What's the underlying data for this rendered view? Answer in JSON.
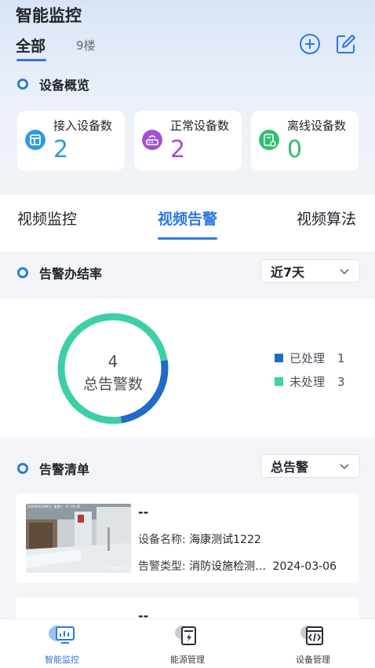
{
  "header": {
    "title": "智能监控",
    "tabs": [
      {
        "label": "全部",
        "active": true
      },
      {
        "label": "9楼",
        "active": false
      }
    ],
    "icons": [
      "add-circle-icon",
      "edit-icon"
    ]
  },
  "overview": {
    "title": "设备概览",
    "cards": [
      {
        "label": "接入设备数",
        "value": "2",
        "icon": "device-icon",
        "color": "#2b9be6"
      },
      {
        "label": "正常设备数",
        "value": "2",
        "icon": "router-icon",
        "color": "#a24fd6"
      },
      {
        "label": "离线设备数",
        "value": "0",
        "icon": "offline-device-icon",
        "color": "#2fbf71"
      }
    ]
  },
  "main_tabs": [
    {
      "label": "视频监控",
      "active": false
    },
    {
      "label": "视频告警",
      "active": true
    },
    {
      "label": "视频算法",
      "active": false
    }
  ],
  "rate_section": {
    "title": "告警办结率",
    "range_select": "近7天"
  },
  "donut": {
    "total_value": "4",
    "total_label": "总告警数",
    "legend": [
      {
        "label": "已处理",
        "count": "1",
        "value": 1,
        "color": "#1f6cc6"
      },
      {
        "label": "未处理",
        "count": "3",
        "value": 3,
        "color": "#3dcfa6"
      }
    ]
  },
  "alarm_list": {
    "title": "告警清单",
    "filter_select": "总告警",
    "items": [
      {
        "title": "--",
        "device_label": "设备名称:",
        "device_name": "海康测试1222",
        "type_label": "告警类型:",
        "type_value": "消防设施检测…",
        "date": "2024-03-06",
        "thumb_timestamp": "2024年03月06日 星期三 11:19:45",
        "thumb_camera": "Camera 01"
      },
      {
        "title": "--"
      }
    ]
  },
  "bottom_nav": [
    {
      "label": "智能监控",
      "icon": "monitor-chart-icon",
      "active": true
    },
    {
      "label": "能源管理",
      "icon": "energy-icon",
      "active": false
    },
    {
      "label": "设备管理",
      "icon": "device-code-icon",
      "active": false
    }
  ],
  "colors": {
    "accent": "#2b78e4",
    "processed": "#1f6cc6",
    "unprocessed": "#3dcfa6"
  }
}
